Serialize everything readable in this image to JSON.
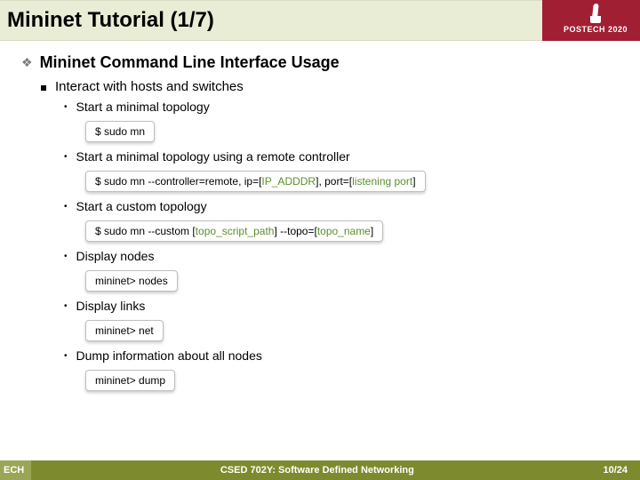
{
  "title": "Mininet Tutorial (1/7)",
  "logo": {
    "line1": "POSTECH",
    "line2": "2020"
  },
  "heading": "Mininet Command Line Interface Usage",
  "sub": "Interact with hosts and switches",
  "items": [
    {
      "label": "Start a minimal topology",
      "cmd_parts": [
        {
          "t": "$ sudo mn",
          "c": "p0"
        }
      ]
    },
    {
      "label": "Start a minimal topology using a remote controller",
      "cmd_parts": [
        {
          "t": "$ sudo mn --controller=remote, ip=[",
          "c": "p0"
        },
        {
          "t": "IP_ADDDR",
          "c": "p1"
        },
        {
          "t": "], port=[",
          "c": "p0"
        },
        {
          "t": "listening port",
          "c": "p1"
        },
        {
          "t": "]",
          "c": "p0"
        }
      ]
    },
    {
      "label": "Start a custom topology",
      "cmd_parts": [
        {
          "t": "$ sudo mn --custom [",
          "c": "p0"
        },
        {
          "t": "topo_script_path",
          "c": "p1"
        },
        {
          "t": "] --topo=[",
          "c": "p0"
        },
        {
          "t": "topo_name",
          "c": "p1"
        },
        {
          "t": "]",
          "c": "p0"
        }
      ]
    },
    {
      "label": "Display nodes",
      "cmd_parts": [
        {
          "t": "mininet> nodes",
          "c": "p0"
        }
      ]
    },
    {
      "label": "Display links",
      "cmd_parts": [
        {
          "t": "mininet> net",
          "c": "p0"
        }
      ]
    },
    {
      "label": "Dump information about all nodes",
      "cmd_parts": [
        {
          "t": "mininet> dump",
          "c": "p0"
        }
      ]
    }
  ],
  "footer": {
    "left": "ECH",
    "center": "CSED 702Y: Software Defined Networking",
    "right": "10/24"
  }
}
